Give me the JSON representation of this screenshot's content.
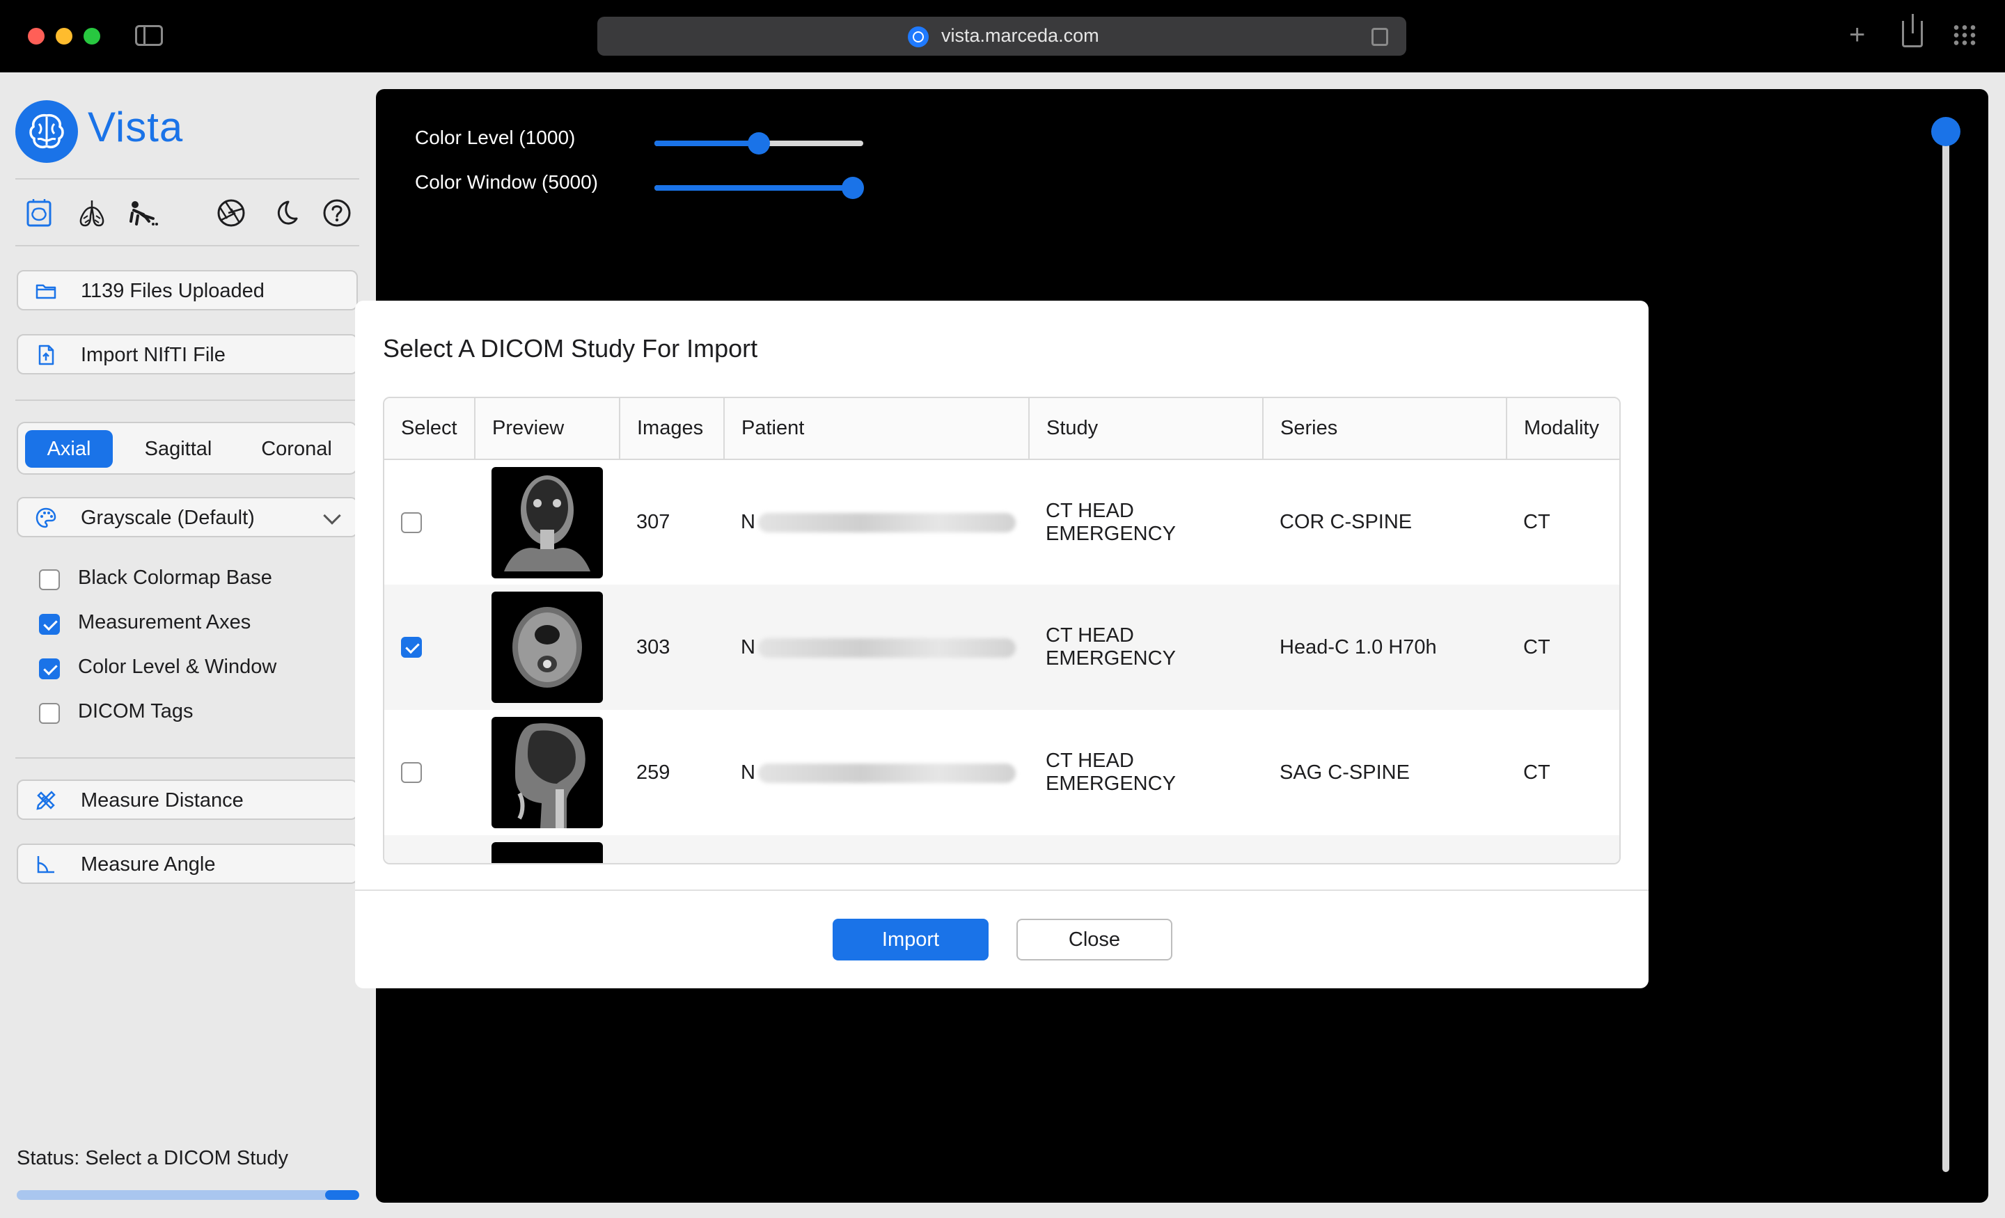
{
  "browser": {
    "url": "vista.marceda.com"
  },
  "app": {
    "name": "Vista",
    "accent_color": "#1a73e8"
  },
  "sidebar": {
    "toolbar_icons": [
      "brain-scan-icon",
      "lungs-icon",
      "body-icon",
      "aperture-icon",
      "moon-icon",
      "help-icon"
    ],
    "files_uploaded_label": "1139 Files Uploaded",
    "import_nifti_label": "Import NIfTI File",
    "views": [
      {
        "label": "Axial",
        "active": true
      },
      {
        "label": "Sagittal",
        "active": false
      },
      {
        "label": "Coronal",
        "active": false
      }
    ],
    "colormap_selected": "Grayscale (Default)",
    "options": [
      {
        "label": "Black Colormap Base",
        "checked": false
      },
      {
        "label": "Measurement Axes",
        "checked": true
      },
      {
        "label": "Color Level & Window",
        "checked": true
      },
      {
        "label": "DICOM Tags",
        "checked": false
      }
    ],
    "measure_distance_label": "Measure Distance",
    "measure_angle_label": "Measure Angle",
    "status_text": "Status: Select a DICOM Study",
    "progress_fraction": 0.1
  },
  "viewer": {
    "color_level_label": "Color Level (1000)",
    "color_level_fraction": 0.5,
    "color_window_label": "Color Window (5000)",
    "color_window_fraction": 0.95,
    "slice_fraction": 0.0
  },
  "modal": {
    "title": "Select A DICOM Study For Import",
    "columns": [
      "Select",
      "Preview",
      "Images",
      "Patient",
      "Study",
      "Series",
      "Modality"
    ],
    "rows": [
      {
        "selected": false,
        "preview": "coronal-ct-thumbnail",
        "images": "307",
        "patient": "N",
        "study": "CT HEAD EMERGENCY",
        "series": "COR C-SPINE",
        "modality": "CT"
      },
      {
        "selected": true,
        "preview": "axial-ct-thumbnail",
        "images": "303",
        "patient": "N",
        "study": "CT HEAD EMERGENCY",
        "series": "Head-C 1.0 H70h",
        "modality": "CT"
      },
      {
        "selected": false,
        "preview": "sagittal-ct-thumbnail",
        "images": "259",
        "patient": "N",
        "study": "CT HEAD EMERGENCY",
        "series": "SAG C-SPINE",
        "modality": "CT"
      }
    ],
    "import_label": "Import",
    "close_label": "Close"
  }
}
